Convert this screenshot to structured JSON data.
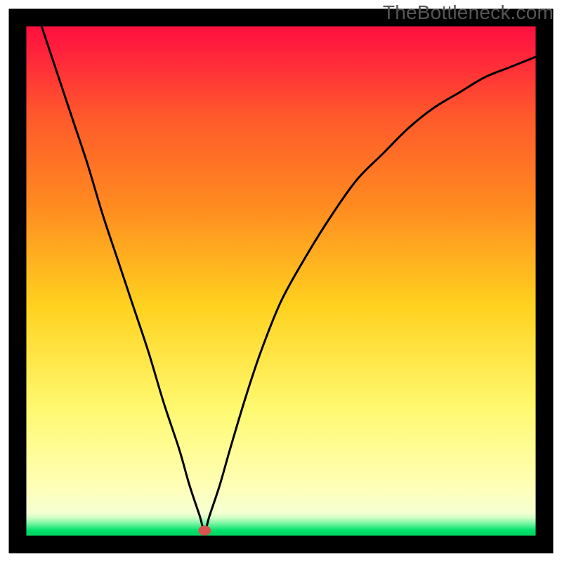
{
  "watermark": "TheBottleneck.com",
  "chart_data": {
    "type": "line",
    "title": "",
    "xlabel": "",
    "ylabel": "",
    "xlim": [
      0,
      100
    ],
    "ylim": [
      0,
      100
    ],
    "grid": false,
    "series": [
      {
        "name": "curve",
        "x": [
          3,
          6,
          9,
          12,
          15,
          18,
          21,
          24,
          27,
          30,
          32,
          34,
          35,
          36,
          38,
          40,
          43,
          46,
          50,
          55,
          60,
          65,
          70,
          75,
          80,
          85,
          90,
          95,
          100
        ],
        "y": [
          100,
          91,
          82,
          73,
          63,
          54,
          45,
          36,
          26,
          17,
          10,
          4,
          1,
          4,
          10,
          17,
          27,
          36,
          46,
          55,
          63,
          70,
          75,
          80,
          84,
          87,
          90,
          92,
          94
        ]
      }
    ],
    "marker": {
      "x": 35,
      "y": 1
    },
    "colors": {
      "gradient_top": "#FF0F3B",
      "gradient_mid1": "#FF8A20",
      "gradient_mid2": "#FFD21F",
      "gradient_mid3": "#FFF970",
      "gradient_mid4": "#FFFFB5",
      "gradient_bottom": "#00E06A",
      "frame": "#000000",
      "curve": "#000000",
      "marker": "#D8544F"
    },
    "layout": {
      "frame_x": 25,
      "frame_y": 25,
      "frame_size": 750,
      "frame_stroke_width": 25
    }
  }
}
